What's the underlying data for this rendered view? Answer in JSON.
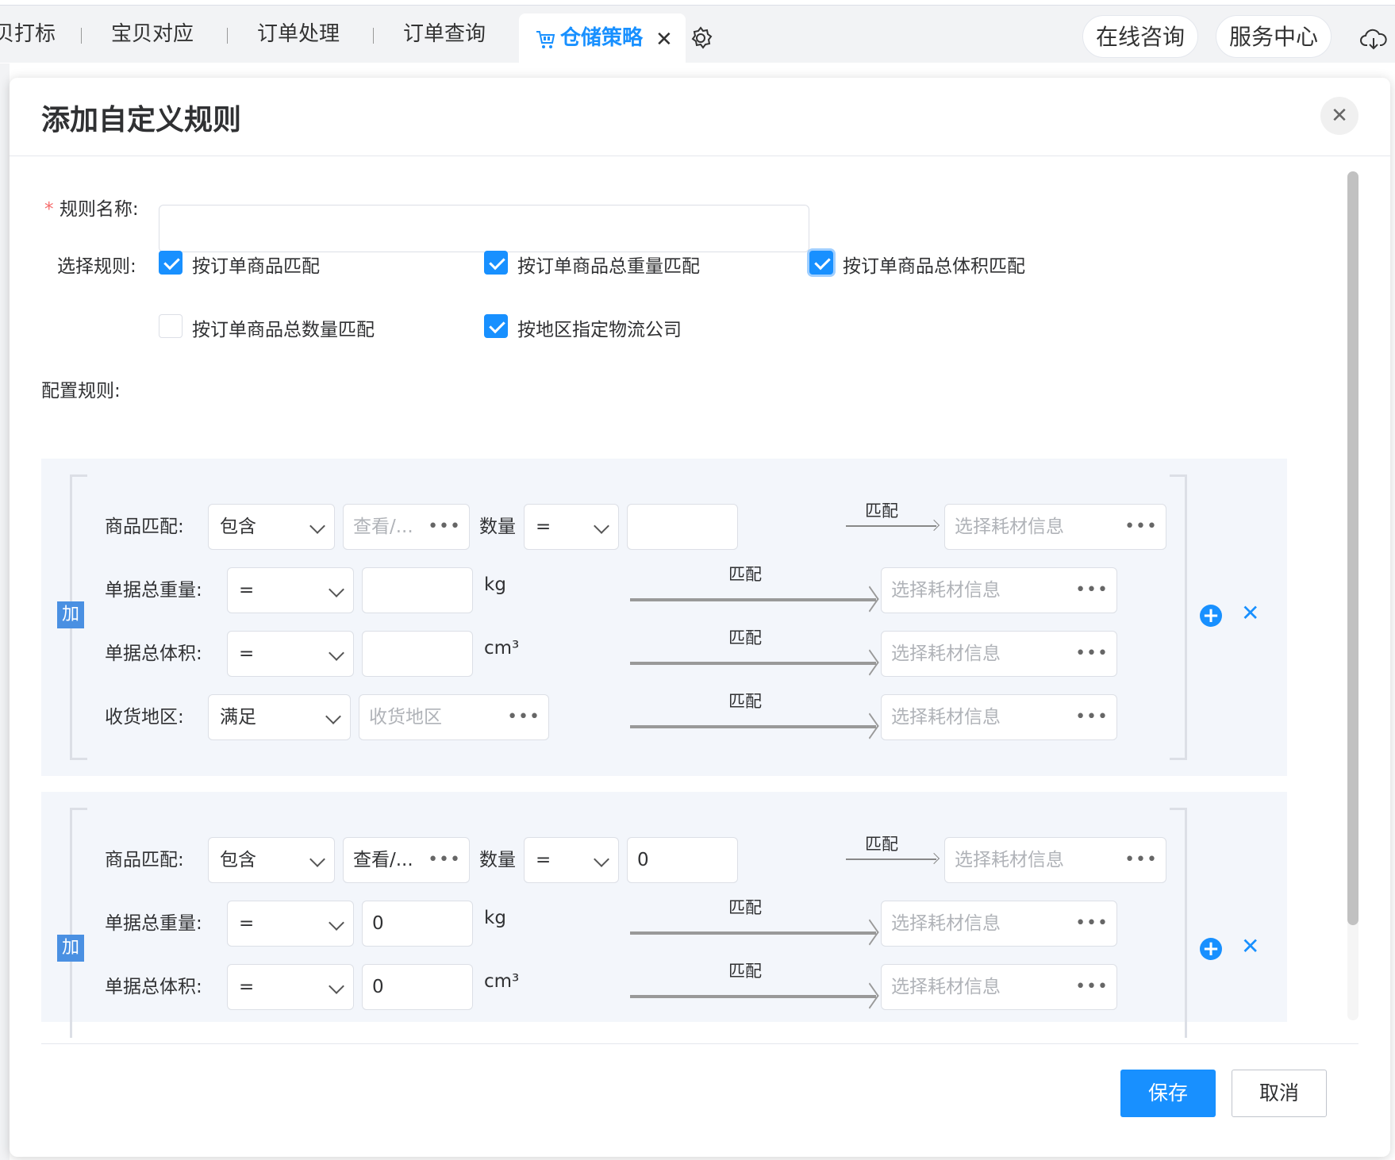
{
  "tabs": [
    {
      "label": "贝打标"
    },
    {
      "label": "宝贝对应"
    },
    {
      "label": "订单处理"
    },
    {
      "label": "订单查询"
    }
  ],
  "active_tab": {
    "label": "仓储策略",
    "icon": "shopping-cart-icon"
  },
  "header_buttons": {
    "consult": "在线咨询",
    "service": "服务中心"
  },
  "dialog": {
    "title": "添加自定义规则",
    "rule_name": {
      "label": "规则名称:",
      "required_mark": "*",
      "value": ""
    },
    "select_rules": {
      "label": "选择规则:",
      "options": [
        {
          "label": "按订单商品匹配",
          "checked": true
        },
        {
          "label": "按订单商品总重量匹配",
          "checked": true
        },
        {
          "label": "按订单商品总体积匹配",
          "checked": true
        },
        {
          "label": "按订单商品总数量匹配",
          "checked": false
        },
        {
          "label": "按地区指定物流公司",
          "checked": true
        }
      ]
    },
    "config_label": "配置规则:",
    "group_badge": "加",
    "match_label": "匹配",
    "material_placeholder": "选择耗材信息",
    "rules": [
      {
        "product": {
          "label": "商品匹配:",
          "op": "包含",
          "view": "查看/...",
          "view_placeholder": true,
          "qty_label": "数量",
          "qty_op": "=",
          "qty_value": ""
        },
        "weight": {
          "label": "单据总重量:",
          "op": "=",
          "value": "",
          "unit": "kg"
        },
        "volume": {
          "label": "单据总体积:",
          "op": "=",
          "value": "",
          "unit": "cm³"
        },
        "region": {
          "label": "收货地区:",
          "op": "满足",
          "placeholder": "收货地区"
        }
      },
      {
        "product": {
          "label": "商品匹配:",
          "op": "包含",
          "view": "查看/...",
          "view_placeholder": false,
          "qty_label": "数量",
          "qty_op": "=",
          "qty_value": "0"
        },
        "weight": {
          "label": "单据总重量:",
          "op": "=",
          "value": "0",
          "unit": "kg"
        },
        "volume": {
          "label": "单据总体积:",
          "op": "=",
          "value": "0",
          "unit": "cm³"
        }
      }
    ],
    "buttons": {
      "save": "保存",
      "cancel": "取消"
    }
  },
  "colors": {
    "primary": "#1890ff",
    "panel": "#f3f6fb",
    "danger": "#f56c6c"
  }
}
